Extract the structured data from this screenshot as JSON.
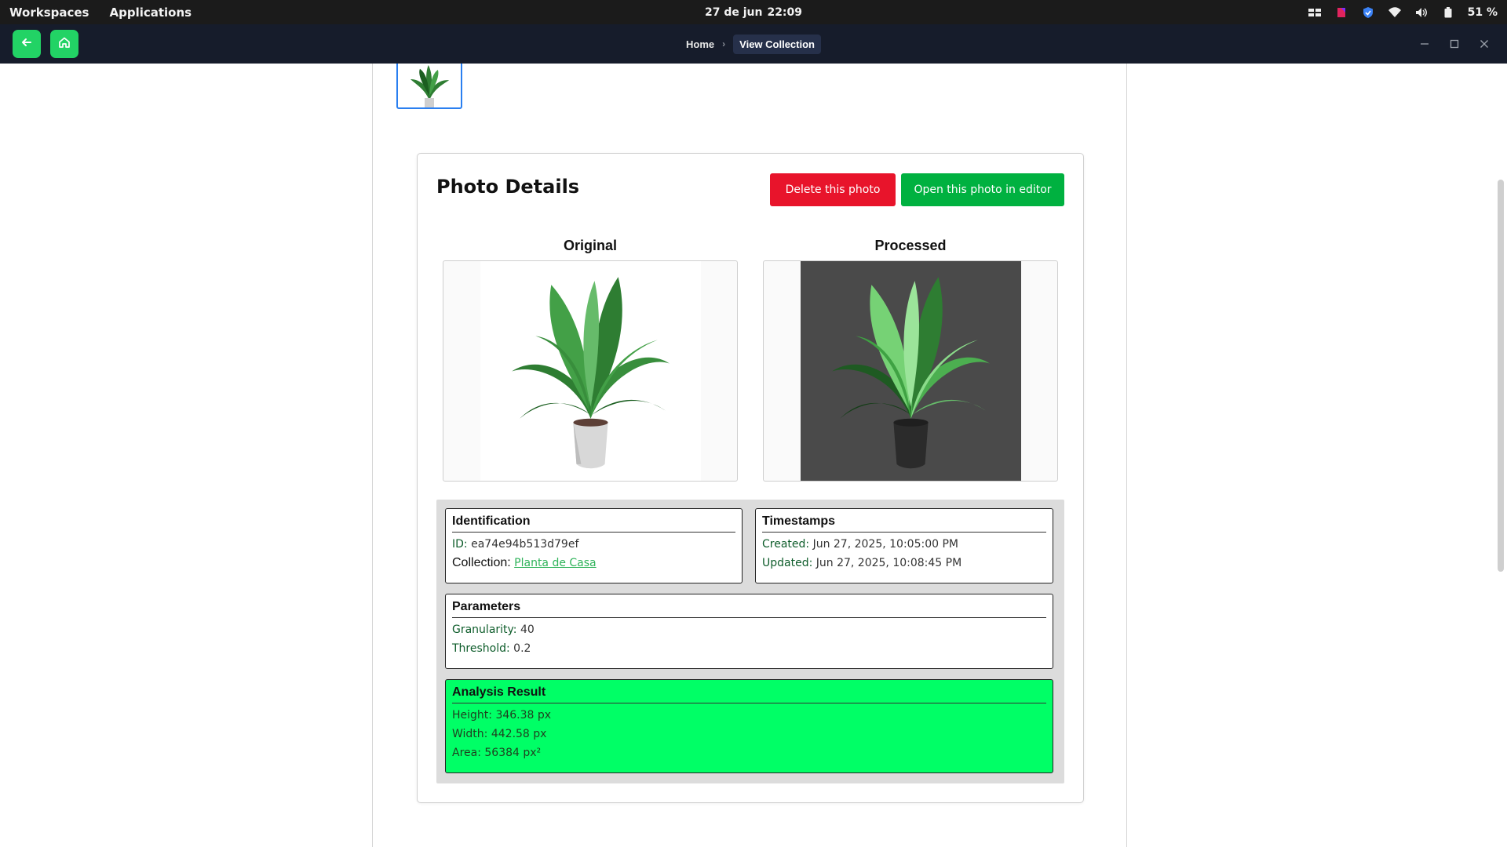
{
  "os": {
    "workspaces": "Workspaces",
    "applications": "Applications",
    "date": "27 de jun",
    "time": "22:09",
    "battery": "51 %"
  },
  "app": {
    "breadcrumb_home": "Home",
    "breadcrumb_sep": "›",
    "breadcrumb_current": "View Collection"
  },
  "card": {
    "title": "Photo Details",
    "delete_label": "Delete this photo",
    "open_label": "Open this photo in editor",
    "original_label": "Original",
    "processed_label": "Processed"
  },
  "identification": {
    "title": "Identification",
    "id_key": "ID:",
    "id_value": "ea74e94b513d79ef",
    "collection_key": "Collection:",
    "collection_value": "Planta de Casa"
  },
  "timestamps": {
    "title": "Timestamps",
    "created_key": "Created:",
    "created_value": "Jun 27, 2025, 10:05:00 PM",
    "updated_key": "Updated:",
    "updated_value": "Jun 27, 2025, 10:08:45 PM"
  },
  "parameters": {
    "title": "Parameters",
    "granularity_key": "Granularity:",
    "granularity_value": "40",
    "threshold_key": "Threshold:",
    "threshold_value": "0.2"
  },
  "analysis": {
    "title": "Analysis Result",
    "height": "Height: 346.38 px",
    "width": "Width: 442.58 px",
    "area": "Area: 56384 px²"
  },
  "colors": {
    "delete": "#e8142b",
    "open": "#00b140",
    "analysis_bg": "#00ff66",
    "nav_button": "#22d365",
    "header_bg": "#161c2b"
  },
  "icons": {
    "back": "arrow-left-icon",
    "home": "home-icon"
  }
}
